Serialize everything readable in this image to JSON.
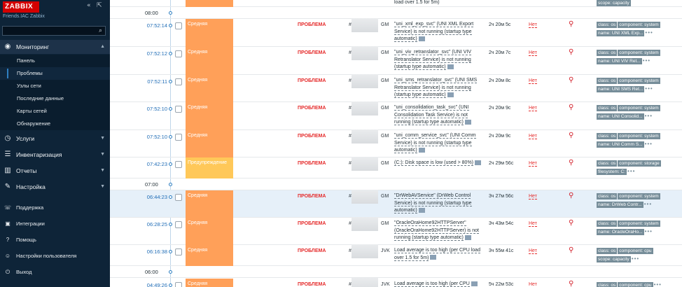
{
  "sidebar": {
    "logo": "ZABBIX",
    "subtitle": "Friends.IAC Zabbix",
    "search_placeholder": "",
    "sections": [
      {
        "label": "Мониторинг",
        "icon": "eye-icon",
        "expanded": true
      },
      {
        "label": "Услуги",
        "icon": "clock-icon"
      },
      {
        "label": "Инвентаризация",
        "icon": "list-icon"
      },
      {
        "label": "Отчеты",
        "icon": "chart-icon"
      },
      {
        "label": "Настройка",
        "icon": "wrench-icon"
      }
    ],
    "monitoring_items": [
      {
        "label": "Панель"
      },
      {
        "label": "Проблемы"
      },
      {
        "label": "Узлы сети"
      },
      {
        "label": "Последние данные"
      },
      {
        "label": "Карты сетей"
      },
      {
        "label": "Обнаружение"
      }
    ],
    "bottom_items": [
      {
        "label": "Поддержка",
        "icon": "support-icon"
      },
      {
        "label": "Интеграции",
        "icon": "integrations-icon"
      },
      {
        "label": "Помощь",
        "icon": "help-icon"
      },
      {
        "label": "Настройки пользователя",
        "icon": "user-icon"
      },
      {
        "label": "Выход",
        "icon": "power-icon"
      }
    ]
  },
  "problems": {
    "top_partial": {
      "desc": "load over 1.5 for 5m)",
      "tags": [
        "scope: capacity"
      ]
    },
    "hour_markers": [
      "08:00",
      "07:00",
      "06:00"
    ],
    "rows": [
      {
        "time": "07:52:14",
        "severity": "Средняя",
        "status": "ПРОБЛЕМА",
        "host_prefix": "#",
        "host_suffix": "GM",
        "desc": "\"uni_xml_exp_svc\" (UNI XML Export Service) is not running (startup type automatic)",
        "duration": "2ч 20м 5с",
        "ack": "Нет",
        "tags": [
          "class: os",
          "component: system",
          "name: UNI XML Exp..."
        ]
      },
      {
        "time": "07:52:12",
        "severity": "Средняя",
        "status": "ПРОБЛЕМА",
        "host_prefix": "#",
        "host_suffix": "GM",
        "desc": "\"uni_viv_retranslator_svc\" (UNI VIV Retranslator Service) is not running (startup type automatic)",
        "duration": "2ч 20м 7с",
        "ack": "Нет",
        "tags": [
          "class: os",
          "component: system",
          "name: UNI VIV Ret..."
        ]
      },
      {
        "time": "07:52:11",
        "severity": "Средняя",
        "status": "ПРОБЛЕМА",
        "host_prefix": "#",
        "host_suffix": "GM",
        "desc": "\"uni_sms_retranslator_svc\" (UNI SMS Retranslator Service) is not running (startup type automatic)",
        "duration": "2ч 20м 8с",
        "ack": "Нет",
        "tags": [
          "class: os",
          "component: system",
          "name: UNI SMS Ret..."
        ]
      },
      {
        "time": "07:52:10",
        "severity": "Средняя",
        "status": "ПРОБЛЕМА",
        "host_prefix": "#",
        "host_suffix": "GM",
        "desc": "\"uni_consolidation_task_svc\" (UNI Consolidation Task Service) is not running (startup type automatic)",
        "duration": "2ч 20м 9с",
        "ack": "Нет",
        "tags": [
          "class: os",
          "component: system",
          "name: UNI Consolid..."
        ]
      },
      {
        "time": "07:52:10",
        "severity": "Средняя",
        "status": "ПРОБЛЕМА",
        "host_prefix": "#",
        "host_suffix": "GM",
        "desc": "\"uni_comm_service_svc\" (UNI Comm Service) is not running (startup type automatic)",
        "duration": "2ч 20м 9с",
        "ack": "Нет",
        "tags": [
          "class: os",
          "component: system",
          "name: UNI Comm S..."
        ]
      },
      {
        "time": "07:42:23",
        "severity": "Предупреждение",
        "status": "ПРОБЛЕМА",
        "host_prefix": "#",
        "host_suffix": "GM",
        "desc": "(C:): Disk space is low (used > 80%)",
        "duration": "2ч 29м 56с",
        "ack": "Нет",
        "tags": [
          "class: os",
          "component: storage",
          "filesystem: C:"
        ]
      },
      {
        "time": "06:44:23",
        "severity": "Средняя",
        "status": "ПРОБЛЕМА",
        "host_prefix": "#",
        "host_suffix": "GM",
        "desc": "\"DrWebAVService\" (DrWeb Control Service) is not running (startup type automatic)",
        "duration": "3ч 27м 56с",
        "ack": "Нет",
        "tags": [
          "class: os",
          "component: system",
          "name: DrWeb Contr..."
        ]
      },
      {
        "time": "06:28:25",
        "severity": "Средняя",
        "status": "ПРОБЛЕМА",
        "host_prefix": "#",
        "host_suffix": "GM",
        "desc": "\"OracleOraHome92HTTPServer\" (OracleOraHome92HTTPServer) is not running (startup type automatic)",
        "duration": "3ч 43м 54с",
        "ack": "Нет",
        "tags": [
          "class: os",
          "component: system",
          "name: OracleOraHo..."
        ]
      },
      {
        "time": "06:16:38",
        "severity": "Средняя",
        "status": "ПРОБЛЕМА",
        "host_prefix": "#",
        "host_suffix": "JVK",
        "desc": "Load average is too high (per CPU load over 1.5 for 5m)",
        "duration": "3ч 55м 41с",
        "ack": "Нет",
        "tags": [
          "class: os",
          "component: cpu",
          "scope: capacity"
        ]
      },
      {
        "time": "04:49:26",
        "severity": "Средняя",
        "status": "ПРОБЛЕМА",
        "host_prefix": "#",
        "host_suffix": "JVK",
        "desc": "Load average is too high (per CPU",
        "duration": "5ч 22м 53с",
        "ack": "Нет",
        "tags": [
          "class: os",
          "component: cpu"
        ]
      }
    ]
  },
  "colors": {
    "sidebar_bg": "#0e2438",
    "severity_average": "#ffa059",
    "severity_warning": "#ffc859",
    "problem_red": "#e52b2b",
    "link_blue": "#1f6cb6"
  }
}
